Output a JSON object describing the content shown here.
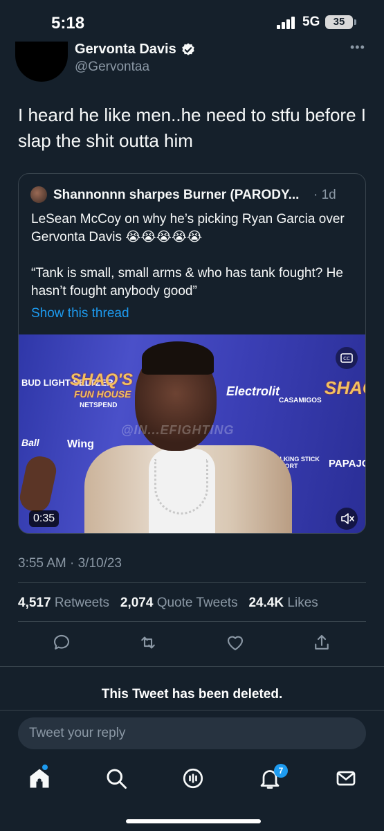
{
  "status_bar": {
    "time": "5:18",
    "network": "5G",
    "battery": "35"
  },
  "tweet": {
    "author_name": "Gervonta Davis",
    "handle": "@Gervontaa",
    "text": "I heard he like men..he need to stfu before I slap the shit outta him",
    "timestamp": "3:55 AM · 3/10/23"
  },
  "quote": {
    "author_name": "Shannonnn sharpes Burner (PARODY...",
    "time": "· 1d",
    "line1": "LeSean McCoy on why he’s picking Ryan Garcia over Gervonta Davis",
    "emojis": "😭😭😭😭😭",
    "line2": "“Tank is small, small arms & who has tank fought? He hasn’t fought anybody good”",
    "show_thread": "Show this thread",
    "video": {
      "duration": "0:35",
      "signs": {
        "shaqs": "SHAQ'S",
        "fun_house": "FUN HOUSE",
        "netspend": "NETSPEND",
        "electrolit": "Electrolit",
        "casamigos": "CASAMIGOS",
        "talking_stick": "TALKING STICK RESORT",
        "papa_john": "PAPAJO",
        "bud_light": "BUD LIGHT SELTZER",
        "wing": "Wing",
        "ball": "Ball",
        "watermark": "@IN...EFIGHTING"
      }
    }
  },
  "stats": {
    "retweets_count": "4,517",
    "retweets_label": "Retweets",
    "quotes_count": "2,074",
    "quotes_label": "Quote Tweets",
    "likes_count": "24.4K",
    "likes_label": "Likes"
  },
  "deleted_notice": "This Tweet has been deleted.",
  "reply": {
    "placeholder": "Tweet your reply"
  },
  "tabbar": {
    "notifications_badge": "7"
  },
  "colors": {
    "background": "#15202b",
    "accent": "#1d9bf0",
    "muted": "#8b98a5"
  }
}
